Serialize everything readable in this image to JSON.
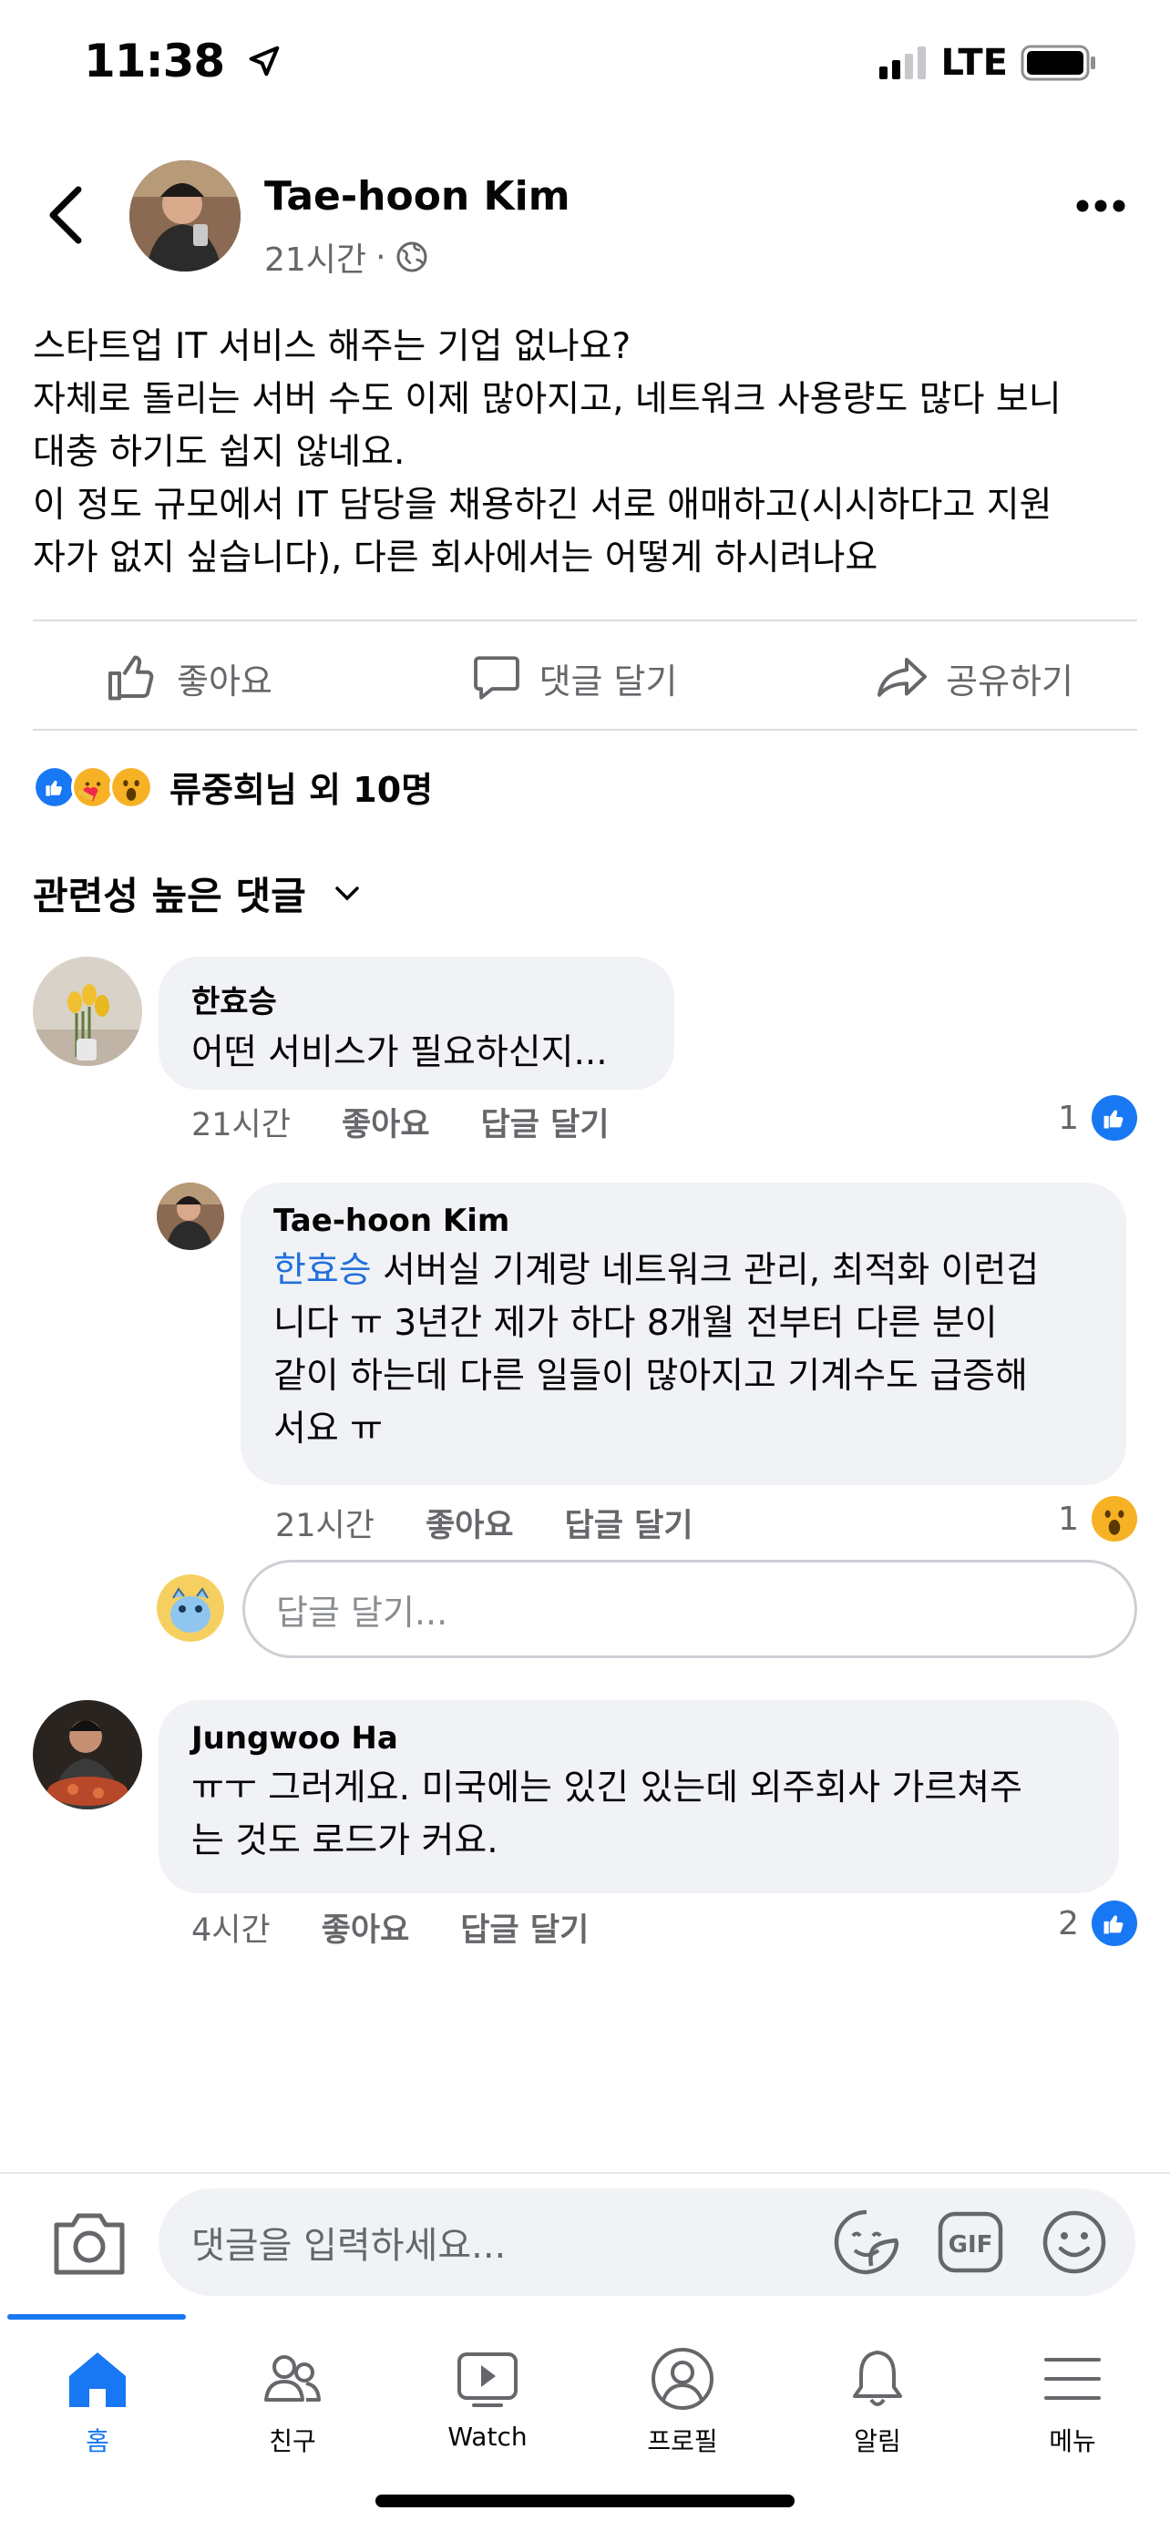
{
  "status_bar": {
    "time": "11:38",
    "network": "LTE"
  },
  "post": {
    "author": "Tae-hoon Kim",
    "time": "21시간",
    "separator": "·",
    "body_lines": [
      "스타트업 IT 서비스 해주는 기업 없나요?",
      "자체로 돌리는 서버 수도 이제 많아지고, 네트워크 사용량도 많다 보니",
      "대충 하기도 쉽지 않네요.",
      "이 정도 규모에서 IT 담당을 채용하긴 서로 애매하고(시시하다고 지원",
      "자가 없지 싶습니다), 다른 회사에서는 어떻게 하시려나요"
    ],
    "actions": {
      "like": "좋아요",
      "comment": "댓글 달기",
      "share": "공유하기"
    },
    "reactions_text": "류중희님 외 10명",
    "sort_label": "관련성 높은 댓글"
  },
  "comments": [
    {
      "name": "한효승",
      "text": "어떤 서비스가 필요하신지...",
      "time": "21시간",
      "like": "좋아요",
      "reply": "답글 달기",
      "count": "1"
    },
    {
      "name": "Tae-hoon Kim",
      "mention": "한효승",
      "text_lines": [
        " 서버실 기계랑 네트워크 관리, 최적화 이런겁",
        "니다 ㅠ  3년간 제가 하다 8개월 전부터 다른 분이",
        "같이 하는데 다른 일들이 많아지고 기계수도 급증해",
        "서요 ㅠ"
      ],
      "time": "21시간",
      "like": "좋아요",
      "reply": "답글 달기",
      "count": "1"
    },
    {
      "name": "Jungwoo Ha",
      "text_lines": [
        "ㅠㅜ 그러게요. 미국에는 있긴 있는데 외주회사 가르쳐주",
        "는 것도 로드가 커요."
      ],
      "time": "4시간",
      "like": "좋아요",
      "reply": "답글 달기",
      "count": "2"
    }
  ],
  "reply_input": {
    "placeholder": "답글 달기..."
  },
  "composer": {
    "placeholder": "댓글을 입력하세요...",
    "gif": "GIF"
  },
  "tabs": [
    {
      "label": "홈",
      "icon": "home-icon",
      "active": true
    },
    {
      "label": "친구",
      "icon": "friends-icon"
    },
    {
      "label": "Watch",
      "icon": "watch-icon"
    },
    {
      "label": "프로필",
      "icon": "profile-icon"
    },
    {
      "label": "알림",
      "icon": "bell-icon"
    },
    {
      "label": "메뉴",
      "icon": "menu-icon"
    }
  ],
  "colors": {
    "accent": "#1877f2",
    "bubble": "#f0f2f5",
    "secondary_text": "#65676b",
    "mention": "#216fdb"
  }
}
